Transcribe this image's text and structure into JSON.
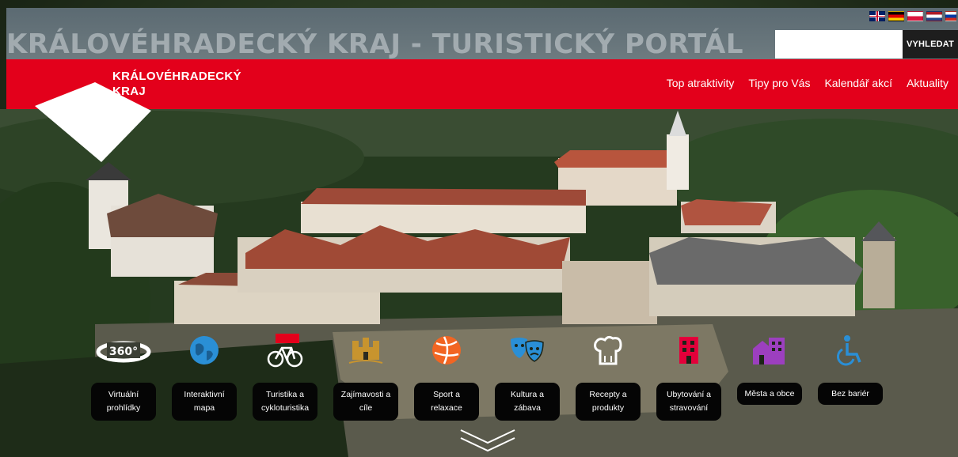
{
  "header": {
    "site_title": "KRÁLOVÉHRADECKÝ KRAJ - TURISTICKÝ PORTÁL",
    "brand_line1": "KRÁLOVÉHRADECKÝ",
    "brand_line2": "KRAJ",
    "search_placeholder": "",
    "search_button": "VYHLEDAT",
    "flags": [
      "uk-flag-icon",
      "de-flag-icon",
      "pl-flag-icon",
      "nl-flag-icon",
      "ru-flag-icon"
    ]
  },
  "nav": {
    "items": [
      {
        "label": "Top atraktivity"
      },
      {
        "label": "Tipy pro Vás"
      },
      {
        "label": "Kalendář akcí"
      },
      {
        "label": "Aktuality"
      }
    ]
  },
  "categories": [
    {
      "label": "Virtuální prohlídky",
      "icon": "360-icon",
      "color": "#ffffff"
    },
    {
      "label": "Interaktivní mapa",
      "icon": "globe-icon",
      "color": "#2a8fd6"
    },
    {
      "label": "Turistika a cykloturistika",
      "icon": "bicycle-icon",
      "color": "#e3001b"
    },
    {
      "label": "Zajímavosti a cíle",
      "icon": "castle-icon",
      "color": "#c8942e"
    },
    {
      "label": "Sport a relaxace",
      "icon": "ball-icon",
      "color": "#f26522"
    },
    {
      "label": "Kultura a zábava",
      "icon": "masks-icon",
      "color": "#2a8fd6"
    },
    {
      "label": "Recepty a produkty",
      "icon": "chef-hat-icon",
      "color": "#ffffff"
    },
    {
      "label": "Ubytování a stravování",
      "icon": "building-icon",
      "color": "#e3003a"
    },
    {
      "label": "Města a obce",
      "icon": "city-icon",
      "color": "#9c3fbf"
    },
    {
      "label": "Bez bariér",
      "icon": "wheelchair-icon",
      "color": "#2a8fd6"
    }
  ],
  "colors": {
    "brand_red": "#e3001b",
    "search_button_bg": "#1e1e1e"
  },
  "scroll_icon": "chevron-down-icon"
}
